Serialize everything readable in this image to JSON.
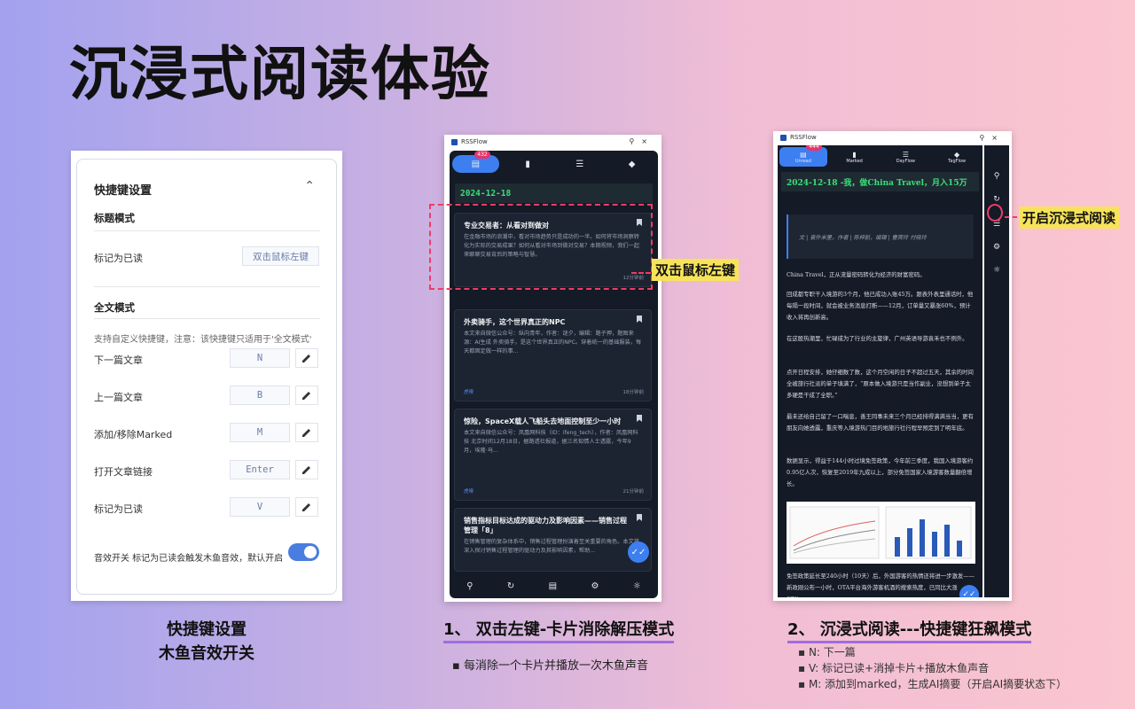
{
  "page_title": "沉浸式阅读体验",
  "settings": {
    "header": "快捷键设置",
    "title_mode": "标题模式",
    "title_row": {
      "label": "标记为已读",
      "key": "双击鼠标左键"
    },
    "fulltext_mode": "全文模式",
    "tip": "支持自定义快捷键，注意：该快捷键只适用于'全文模式'",
    "rows": [
      {
        "label": "下一篇文章",
        "key": "N"
      },
      {
        "label": "上一篇文章",
        "key": "B"
      },
      {
        "label": "添加/移除Marked",
        "key": "M"
      },
      {
        "label": "打开文章链接",
        "key": "Enter"
      },
      {
        "label": "标记为已读",
        "key": "V"
      }
    ],
    "sound_label": "音效开关 标记为已读会触发木鱼音效，默认开启",
    "caption_line1": "快捷键设置",
    "caption_line2": "木鱼音效开关"
  },
  "phone1": {
    "app_title": "RSSFlow",
    "badge": "432",
    "date": "2024-12-18",
    "cards": [
      {
        "title": "专业交易者：从看对到做对",
        "body": "在金融市场的浪潮中，看对市场趋势只是成功的一半。如何将市场洞察转化为实际的交易成果？如何从看对市场到做对交易？本期视频，我们一起来聊聊交易背后的策略与智慧。",
        "source": "",
        "time": "12分钟前"
      },
      {
        "title": "外卖骑手，这个世界真正的NPC",
        "body": "本文来自微信公众号：纵向青年，作者：谜夕，编辑：路子押，题图来源：AI生成 外卖骑手，是这个世界真正的NPC。穿着统一的基础服装，每天都固定做一样的事...",
        "source": "虎嗅",
        "time": "18分钟前"
      },
      {
        "title": "惊险，SpaceX载人飞船头去地面控制至少一小时",
        "body": "本文来自微信公众号：凤凰网科技（ID：ifeng_tech），作者：凤凰网科技 北京时间12月18日，据路透社报道，据三名知情人士透露，今年9月，埃隆·马...",
        "source": "虎嗅",
        "time": "21分钟前"
      },
      {
        "title": "销售指标目标达成的驱动力及影响因素——销售过程管理「8」",
        "body": "在销售管理的复杂体系中，销售过程管理扮演着至关重要的角色。本文将深入探讨销售过程管理的驱动力及其影响因素，帮助...",
        "source": "",
        "time": ""
      }
    ],
    "callout": "双击鼠标左键",
    "caption": "1、 双击左键-卡片消除解压模式",
    "bullet": "每消除一个卡片并播放一次木鱼声音"
  },
  "phone2": {
    "app_title": "RSSFlow",
    "badge": "444",
    "tabs": [
      "Unread",
      "Marked",
      "DayFlow",
      "TagFlow"
    ],
    "date": "2024-12-18 -我，做China Travel，月入15万",
    "quote": "文 | 衰外米里，作者 | 陈梓航，编辑 | 曹宾玲 付晓玲",
    "paragraphs": [
      "China Travel，正从流量密码转化为经济的财富密码。",
      "回成都专职干入境游的3个月，他已成功入账45万。跟表外表里通话时，他每隔一段时间，就会被业务消息打断——12月，订单量又暴涨60%，预计收入将再创新高。",
      "在这股热潮里，忙碌成为了行业的主旋律，广州英语导游袁禾也不例外。",
      "点开日程安排，她仔细数了数，这个月空闲的日子不超过五天，其余的时间全被旅行社派的单子填满了，“原本做入境游只是当作副业，没想到单子太多硬是干成了全职。”",
      "最未还给自己留了一口喘息，善王同事未来三个月已经排得满满当当，更有朋友向她透露，重庆等入境游热门目的地旅行社行程早预定到了明年底。",
      "数据显示，得益于144小时过境免签政策，今年前三季度，我国入境游客约0.95亿人次，恢复至2019年九成以上，部分免签国家入境游客数量翻倍增长。",
      "免签政策延长至240小时（10天）后，外国游客的热情还将进一步激发——新政刚公布一小时，OTA平台海外游客机酒的搜索热度，已同比大涨87%。"
    ],
    "callout": "开启沉浸式阅读",
    "caption": "2、 沉浸式阅读---快捷键狂飙模式",
    "bullets": [
      "N: 下一篇",
      "V: 标记已读+消掉卡片+播放木鱼声音",
      "M: 添加到marked，生成AI摘要（开启AI摘要状态下）"
    ]
  },
  "colors": {
    "accent": "#3d7ff0",
    "highlight": "#f7e35a",
    "dash": "#ee3c66",
    "date_green": "#39e079"
  }
}
